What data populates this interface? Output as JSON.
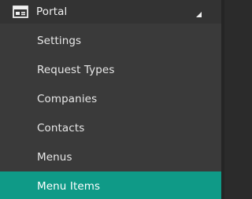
{
  "menu": {
    "parent": {
      "label": "Portal",
      "icon": "window-icon",
      "caret_icon": "caret-up-icon",
      "expanded": true
    },
    "items": [
      {
        "label": "Settings",
        "active": false
      },
      {
        "label": "Request Types",
        "active": false
      },
      {
        "label": "Companies",
        "active": false
      },
      {
        "label": "Contacts",
        "active": false
      },
      {
        "label": "Menus",
        "active": false
      },
      {
        "label": "Menu Items",
        "active": true
      }
    ]
  },
  "colors": {
    "background": "#3a3a3a",
    "parent_background": "#333333",
    "active_background": "#0f9a87",
    "text": "#e8e8e8"
  }
}
